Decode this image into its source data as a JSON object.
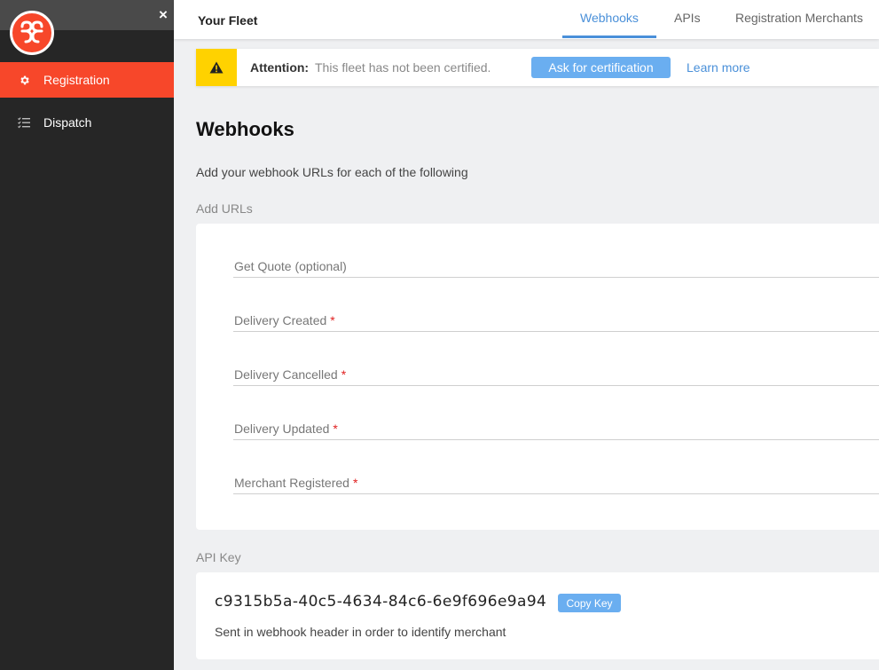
{
  "sidebar": {
    "close_symbol": "×",
    "logo_icon": "brand-logo-icon",
    "items": [
      {
        "label": "Registration",
        "icon": "gear-icon",
        "active": true
      },
      {
        "label": "Dispatch",
        "icon": "checklist-icon",
        "active": false
      }
    ]
  },
  "header": {
    "title": "Your Fleet",
    "tabs": [
      {
        "label": "Webhooks",
        "active": true
      },
      {
        "label": "APIs",
        "active": false
      },
      {
        "label": "Registration Merchants",
        "active": false
      }
    ]
  },
  "attention": {
    "label": "Attention:",
    "message": "This fleet has not been certified.",
    "button_label": "Ask for certification",
    "link_label": "Learn more",
    "icon": "warning-icon"
  },
  "page": {
    "title": "Webhooks",
    "subtitle": "Add your webhook URLs for each of the following",
    "urls_label": "Add URLs",
    "fields": [
      {
        "label": "Get Quote (optional)",
        "required": false,
        "value": ""
      },
      {
        "label": "Delivery Created",
        "required": true,
        "value": ""
      },
      {
        "label": "Delivery Cancelled",
        "required": true,
        "value": ""
      },
      {
        "label": "Delivery Updated",
        "required": true,
        "value": ""
      },
      {
        "label": "Merchant Registered",
        "required": true,
        "value": ""
      }
    ],
    "required_mark": "*",
    "api_label": "API Key",
    "api_key": "c9315b5a-40c5-4634-84c6-6e9f696e9a94",
    "copy_label": "Copy Key",
    "api_hint": "Sent in webhook header in order to identify merchant"
  },
  "colors": {
    "brand": "#f7472a",
    "accent": "#4a90d9",
    "button": "#6aaef0",
    "warning": "#ffd200",
    "sidebar_bg": "#262626"
  }
}
